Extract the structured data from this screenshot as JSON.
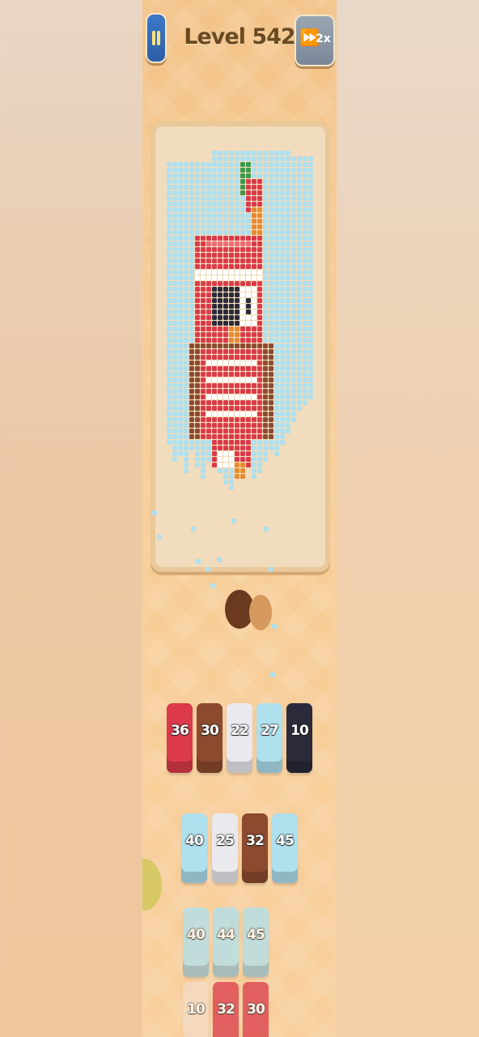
{
  "header": {
    "level_title": "Level 542",
    "speed_label": "2x",
    "pause_icon": "pause-icon",
    "speed_icon": "fast-forward-icon"
  },
  "colors": {
    "red": "#dc3a4a",
    "brown": "#8c4a2e",
    "white": "#e9e9ee",
    "light_blue": "#aee0ee",
    "navy": "#2a2a3a"
  },
  "color_queue": [
    {
      "value": "36",
      "color": "#dc3a4a"
    },
    {
      "value": "30",
      "color": "#8c4a2e"
    },
    {
      "value": "22",
      "color": "#e9e9ee"
    },
    {
      "value": "27",
      "color": "#aee0ee"
    },
    {
      "value": "10",
      "color": "#2a2a3a"
    }
  ],
  "tile_rows": [
    [
      {
        "value": "40",
        "color": "#aee0ee"
      },
      {
        "value": "25",
        "color": "#e9e9ee"
      },
      {
        "value": "32",
        "color": "#8c4a2e"
      },
      {
        "value": "45",
        "color": "#aee0ee"
      }
    ],
    [
      {
        "value": "40",
        "color": "#aee0ee"
      },
      {
        "value": "44",
        "color": "#aee0ee"
      },
      {
        "value": "45",
        "color": "#aee0ee"
      }
    ],
    [
      {
        "value": "10",
        "color": "#f3dcc7"
      },
      {
        "value": "32",
        "color": "#dc3a4a"
      },
      {
        "value": "30",
        "color": "#dc3a4a"
      }
    ]
  ]
}
